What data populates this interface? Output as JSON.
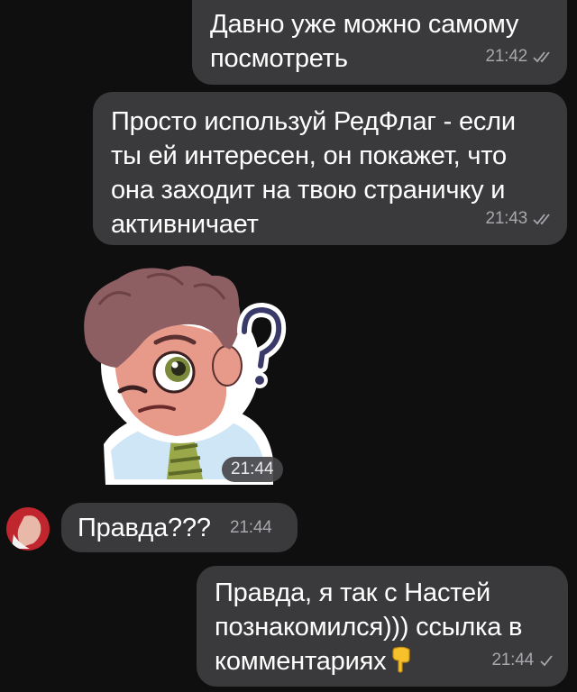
{
  "messages": [
    {
      "id": "m1",
      "direction": "outgoing",
      "text": "Давно уже можно самому\nпосмотреть",
      "time": "21:42",
      "status": "read"
    },
    {
      "id": "m2",
      "direction": "outgoing",
      "text": "Просто используй РедФлаг - если\nты ей интересен, он покажет, что\nона заходит на твою страничку и\nактивничает",
      "time": "21:43",
      "status": "read"
    },
    {
      "id": "m3",
      "direction": "incoming",
      "type": "sticker",
      "sticker_icon": "confused-guy-question-mark-sticker",
      "time": "21:44"
    },
    {
      "id": "m4",
      "direction": "incoming",
      "text": "Правда???",
      "time": "21:44"
    },
    {
      "id": "m5",
      "direction": "outgoing",
      "text": "Правда, я так с Настей\nпознакомился))) ссылка в\nкомментариях",
      "emoji_icon": "backhand-index-pointing-down-emoji",
      "time": "21:44",
      "status": "sent"
    }
  ],
  "colors": {
    "background": "#0f0f10",
    "bubble": "#3a3a3c",
    "text": "#ffffff",
    "meta": "#a7a7ac"
  }
}
